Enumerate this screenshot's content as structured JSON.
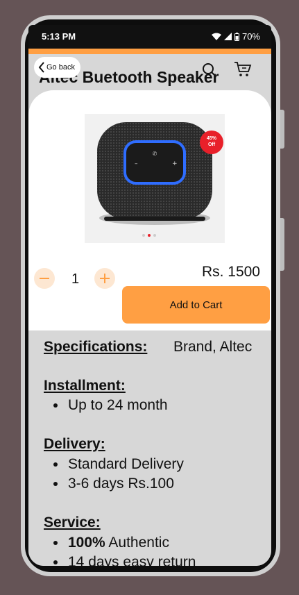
{
  "status_bar": {
    "time": "5:13 PM",
    "battery": "70%"
  },
  "header": {
    "back_label": "Go back",
    "title": "Altec Buetooth Speaker"
  },
  "product": {
    "discount_line1": "45%",
    "discount_line2": "Off",
    "image_dots": 3,
    "active_dot": 2
  },
  "purchase": {
    "quantity": "1",
    "price": "Rs. 1500",
    "add_to_cart": "Add to Cart"
  },
  "details": {
    "specifications_label": "Specifications:",
    "specifications_value": "Brand, Altec",
    "installment_label": "Installment:",
    "installment_items": [
      "Up to 24  month"
    ],
    "delivery_label": "Delivery:",
    "delivery_items": [
      "Standard Delivery",
      "3-6 days  Rs.100"
    ],
    "service_label": "Service:",
    "service_items": [
      {
        "bold": "100%",
        "text": " Authentic"
      },
      {
        "bold": "",
        "text": "14 days easy return"
      }
    ]
  },
  "colors": {
    "accent": "#ff9f43",
    "discount": "#e8202a",
    "qty_button_bg": "#fde7d2"
  },
  "icons": [
    "wifi-icon",
    "signal-icon",
    "battery-icon",
    "chevron-left-icon",
    "search-icon",
    "cart-icon",
    "minus-icon",
    "plus-icon"
  ]
}
